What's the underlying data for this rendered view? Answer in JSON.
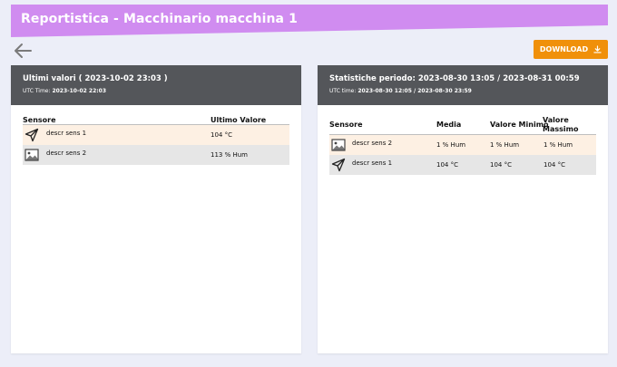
{
  "header": {
    "title": "Reportistica - Macchinario macchina 1",
    "banner_color": "#d08cf0"
  },
  "toolbar": {
    "back_icon": "arrow-left-icon",
    "download_label": "DOWNLOAD",
    "download_icon": "download-icon",
    "download_color": "#f0900a"
  },
  "left_panel": {
    "title": "Ultimi valori ( 2023-10-02 23:03 )",
    "utc_label": "UTC Time:",
    "utc_value": "2023-10-02 22:03",
    "columns": [
      "Sensore",
      "Ultimo Valore"
    ],
    "rows": [
      {
        "icon": "send-icon",
        "sensor": "descr sens 1",
        "value": "104 °C"
      },
      {
        "icon": "image-icon",
        "sensor": "descr sens 2",
        "value": "113 % Hum"
      }
    ]
  },
  "right_panel": {
    "title": "Statistiche periodo: 2023-08-30 13:05 / 2023-08-31 00:59",
    "utc_label": "UTC time:",
    "utc_value": "2023-08-30 12:05 / 2023-08-30 23:59",
    "columns": {
      "sensor": "Sensore",
      "media": "Media",
      "min": "Valore Minimo",
      "max_line1": "Valore",
      "max_line2": "Massimo"
    },
    "rows": [
      {
        "icon": "image-icon",
        "sensor": "descr sens 2",
        "media": "1 % Hum",
        "min": "1 % Hum",
        "max": "1 % Hum"
      },
      {
        "icon": "send-icon",
        "sensor": "descr sens 1",
        "media": "104 °C",
        "min": "104 °C",
        "max": "104 °C"
      }
    ]
  },
  "colors": {
    "page_background": "#eceef8",
    "panel_header": "#54565a",
    "row_highlight": "#fdf0e3",
    "row_alt": "#e6e6e6"
  }
}
